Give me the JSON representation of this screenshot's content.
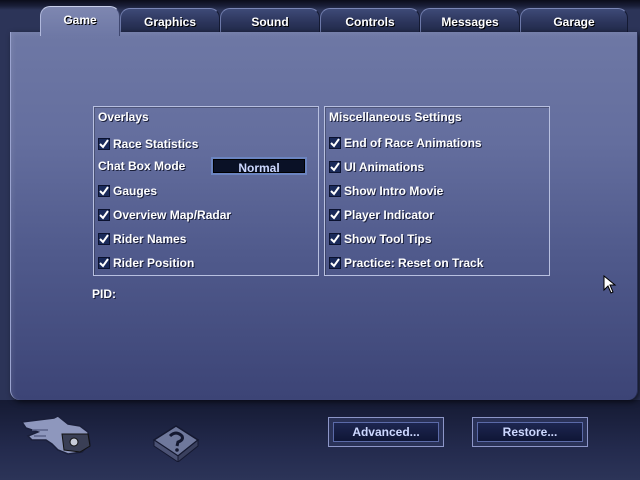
{
  "tabs": [
    {
      "label": "Game",
      "active": true
    },
    {
      "label": "Graphics",
      "active": false
    },
    {
      "label": "Sound",
      "active": false
    },
    {
      "label": "Controls",
      "active": false
    },
    {
      "label": "Messages",
      "active": false
    },
    {
      "label": "Garage",
      "active": false
    }
  ],
  "overlays": {
    "title": "Overlays",
    "race_statistics": {
      "label": "Race Statistics",
      "checked": true
    },
    "chat_box_mode": {
      "label": "Chat Box Mode",
      "value": "Normal"
    },
    "gauges": {
      "label": "Gauges",
      "checked": true
    },
    "overview_map": {
      "label": "Overview Map/Radar",
      "checked": true
    },
    "rider_names": {
      "label": "Rider Names",
      "checked": true
    },
    "rider_position": {
      "label": "Rider Position",
      "checked": true
    }
  },
  "misc": {
    "title": "Miscellaneous Settings",
    "items": [
      {
        "label": "End of Race Animations",
        "checked": true
      },
      {
        "label": "UI Animations",
        "checked": true
      },
      {
        "label": "Show Intro Movie",
        "checked": true
      },
      {
        "label": "Player Indicator",
        "checked": true
      },
      {
        "label": "Show Tool Tips",
        "checked": true
      },
      {
        "label": "Practice: Reset on Track",
        "checked": true
      }
    ]
  },
  "pid_label": "PID:",
  "buttons": {
    "advanced": "Advanced...",
    "restore": "Restore..."
  },
  "icons": {
    "back": "pointing-hand-icon",
    "help": "help-book-icon"
  },
  "colors": {
    "panel": "#6e78a5",
    "checkbox": "#1a2a5a",
    "button_text": "#cdd8ff"
  }
}
